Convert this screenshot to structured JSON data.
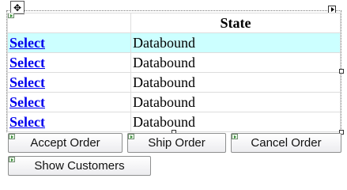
{
  "grid": {
    "columns": [
      "",
      "State"
    ],
    "rows": [
      {
        "action": "Select",
        "state": "Databound"
      },
      {
        "action": "Select",
        "state": "Databound"
      },
      {
        "action": "Select",
        "state": "Databound"
      },
      {
        "action": "Select",
        "state": "Databound"
      },
      {
        "action": "Select",
        "state": "Databound"
      }
    ]
  },
  "buttons": {
    "accept": "Accept Order",
    "ship": "Ship Order",
    "cancel": "Cancel Order",
    "show_customers": "Show Customers"
  },
  "colors": {
    "selected_row": "#ccffff",
    "link": "#0000ee",
    "grid_line": "#dddddd"
  },
  "icons": {
    "move_handle": "move-arrows-icon",
    "smart_tag": "smart-tag-arrow-icon",
    "control_glyph": "designer-glyph-icon"
  }
}
